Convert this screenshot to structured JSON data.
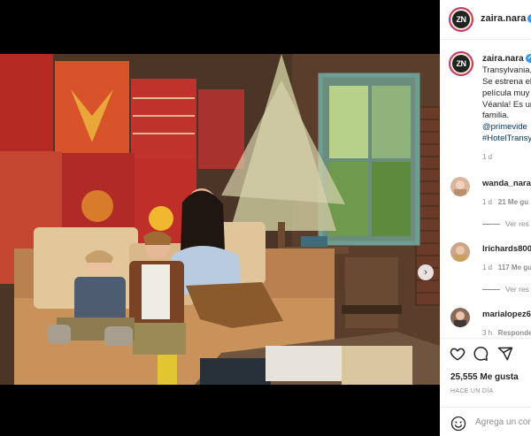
{
  "media": {
    "alt": "",
    "next_icon": "›"
  },
  "header": {
    "avatar_initials": "ZN",
    "username": "zaira.nara",
    "verified_glyph": "✓"
  },
  "caption": {
    "username": "zaira.nara",
    "verified_glyph": "✓",
    "lines": [
      "Transylvania,",
      "Se estrena el",
      "película muy",
      "Véanla! Es un",
      "familia."
    ],
    "links": [
      "@primevide",
      "#HotelTransy"
    ],
    "age": "1 d"
  },
  "comments": [
    {
      "username": "wanda_nara",
      "age": "1 d",
      "likes": "21 Me gu",
      "replies": "Ver res"
    },
    {
      "username": "lrichards800",
      "age": "1 d",
      "likes": "117 Me gu",
      "replies": "Ver res"
    },
    {
      "username": "marialopez6",
      "age": "3 h",
      "likes": "Responde"
    }
  ],
  "actions": {
    "like_icon": "heart-icon",
    "comment_icon": "comment-icon",
    "share_icon": "share-icon"
  },
  "likes_text": "25,555 Me gusta",
  "timestamp": "HACE UN DÍA",
  "comment_box": {
    "placeholder": "Agrega un comentario...",
    "visible_text": "Agrega un cor",
    "emoji_icon": "emoji-icon"
  },
  "colors": {
    "link": "#00376b",
    "muted": "#8e8e8e",
    "verified": "#3897f0"
  }
}
